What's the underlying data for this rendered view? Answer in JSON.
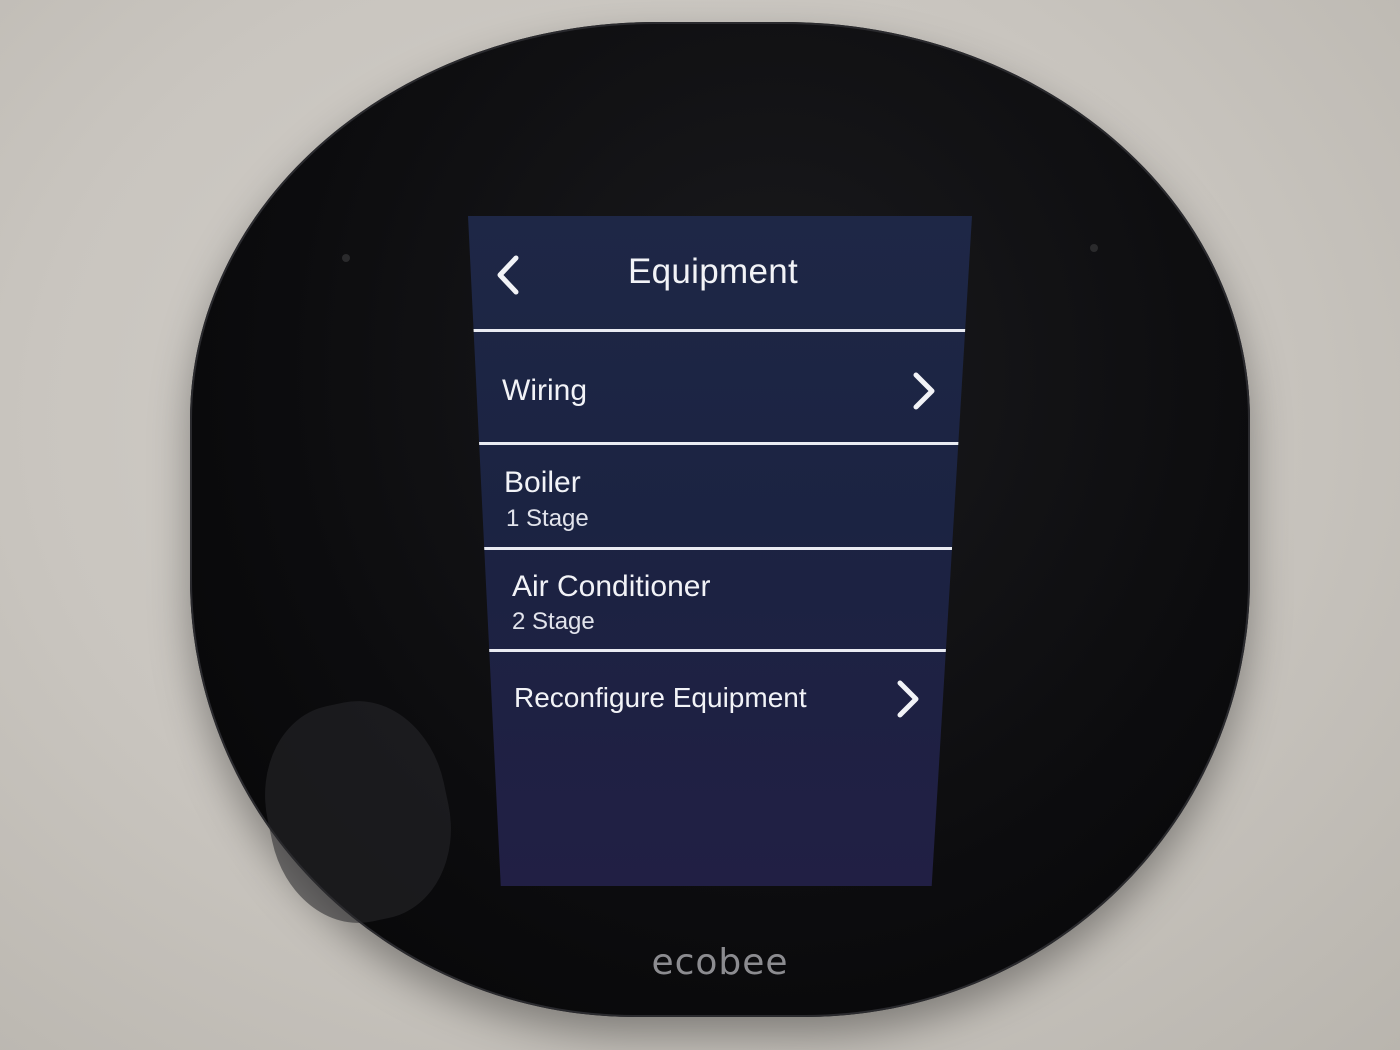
{
  "screen": {
    "title": "Equipment",
    "back_icon": "chevron-left-icon"
  },
  "menu": {
    "items": [
      {
        "label": "Wiring",
        "sublabel": "",
        "icon": "chevron-right-icon"
      },
      {
        "label": "Boiler",
        "sublabel": "1 Stage"
      },
      {
        "label": "Air Conditioner",
        "sublabel": "2 Stage"
      },
      {
        "label": "Reconfigure Equipment",
        "sublabel": "",
        "icon": "chevron-right-icon"
      }
    ]
  },
  "device": {
    "brand": "ecobee"
  },
  "colors": {
    "screen_background": "#1e2746",
    "text": "#f2f3f7",
    "bezel": "#0c0c0e",
    "wall": "#cdc9c3"
  }
}
